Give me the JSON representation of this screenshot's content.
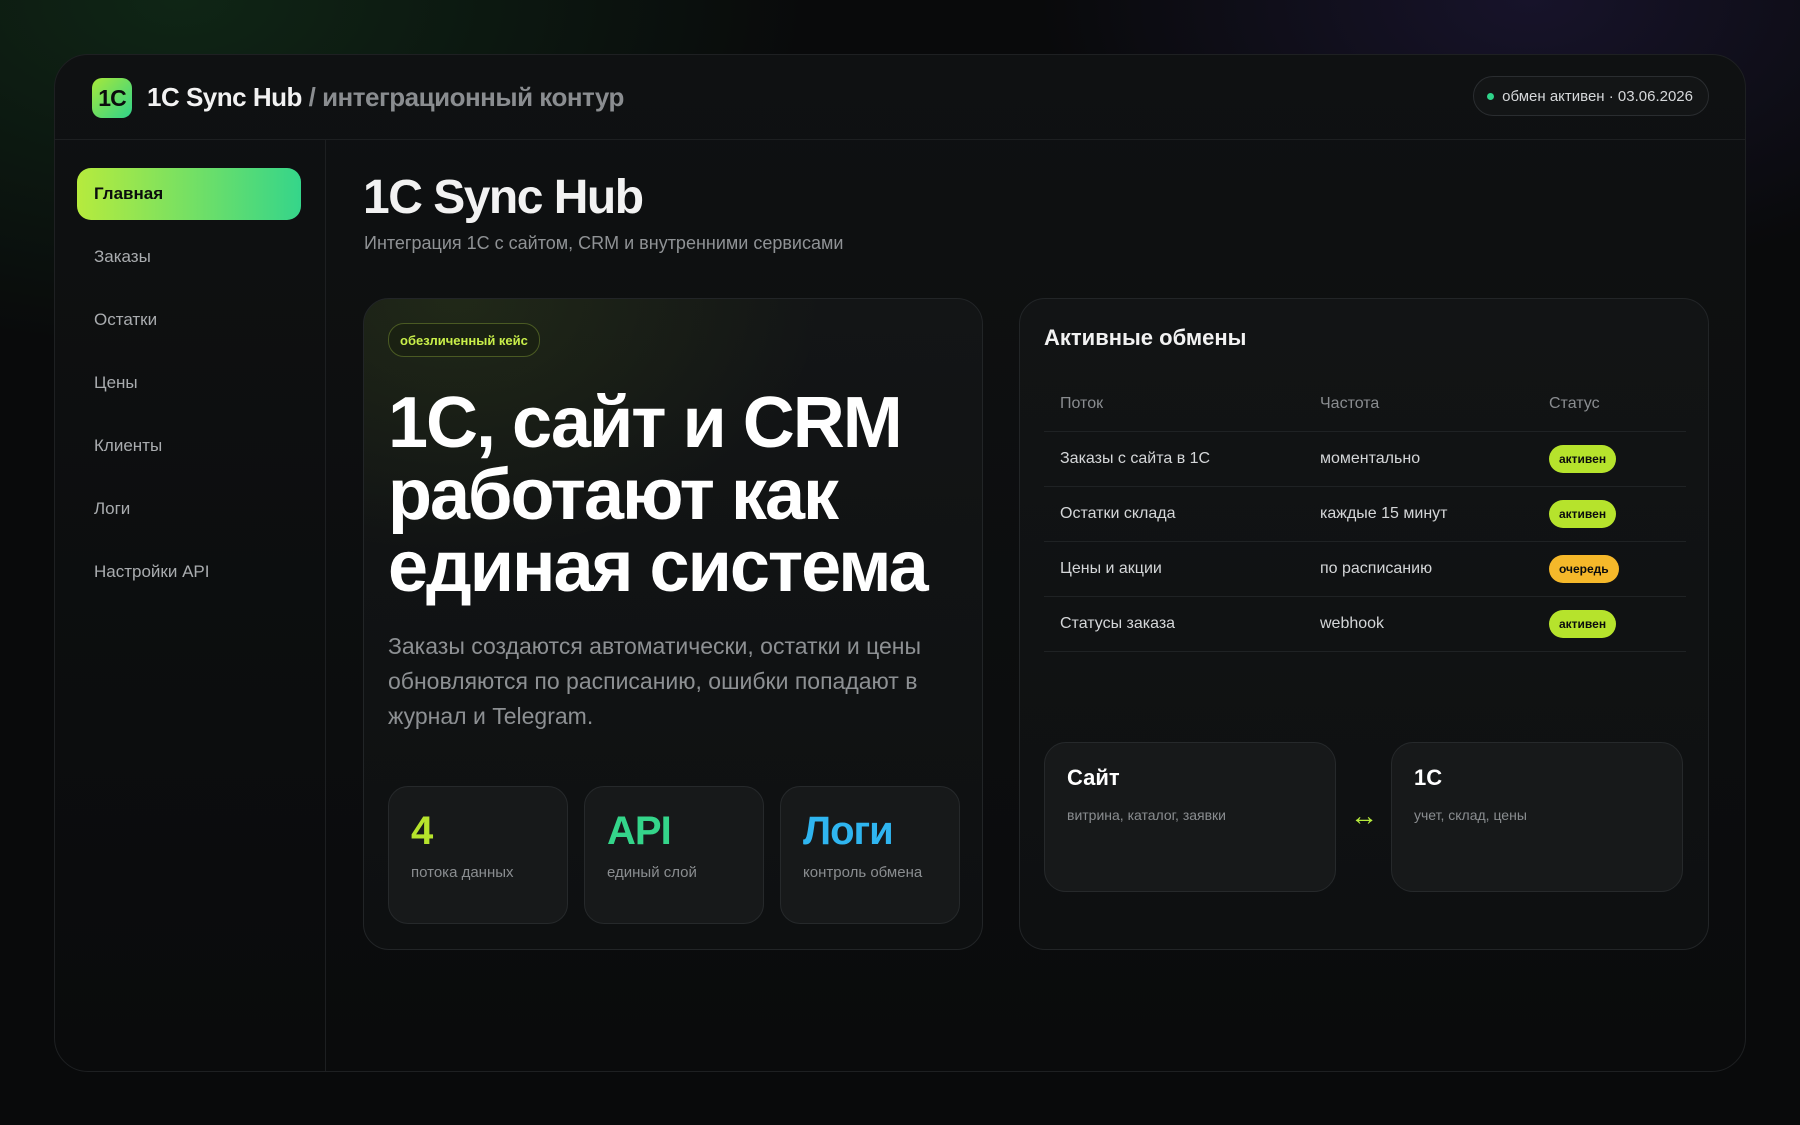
{
  "header": {
    "logo_text": "1C",
    "app_name": "1C Sync Hub",
    "separator": "/",
    "context": "интеграционный контур",
    "status_text": "обмен активен · 03.06.2026"
  },
  "sidebar": {
    "items": [
      {
        "label": "Главная",
        "active": true
      },
      {
        "label": "Заказы"
      },
      {
        "label": "Остатки"
      },
      {
        "label": "Цены"
      },
      {
        "label": "Клиенты"
      },
      {
        "label": "Логи"
      },
      {
        "label": "Настройки API"
      }
    ]
  },
  "main": {
    "title": "1C Sync Hub",
    "subtitle": "Интеграция 1С с сайтом, CRM и внутренними сервисами"
  },
  "hero": {
    "badge": "обезличенный кейс",
    "title": "1С, сайт и CRM работают как единая система",
    "text": "Заказы создаются автоматически, остатки и цены обновляются по расписанию, ошибки попадают в журнал и Telegram.",
    "stats": [
      {
        "value": "4",
        "caption": "потока данных",
        "color": "#b6e32c"
      },
      {
        "value": "API",
        "caption": "единый слой",
        "color": "#34d58a"
      },
      {
        "value": "Логи",
        "caption": "контроль обмена",
        "color": "#2fb5f0"
      }
    ]
  },
  "exchanges": {
    "title": "Активные обмены",
    "columns": [
      "Поток",
      "Частота",
      "Статус"
    ],
    "rows": [
      {
        "flow": "Заказы с сайта в 1С",
        "frequency": "моментально",
        "status": "активен",
        "status_color": "#b6e32c"
      },
      {
        "flow": "Остатки склада",
        "frequency": "каждые 15 минут",
        "status": "активен",
        "status_color": "#b6e32c"
      },
      {
        "flow": "Цены и акции",
        "frequency": "по расписанию",
        "status": "очередь",
        "status_color": "#f5b82a"
      },
      {
        "flow": "Статусы заказа",
        "frequency": "webhook",
        "status": "активен",
        "status_color": "#b6e32c"
      }
    ],
    "nodes": [
      {
        "title": "Сайт",
        "desc": "витрина, каталог, заявки"
      },
      {
        "title": "1С",
        "desc": "учет, склад, цены"
      }
    ],
    "arrow_icon": "↔"
  }
}
